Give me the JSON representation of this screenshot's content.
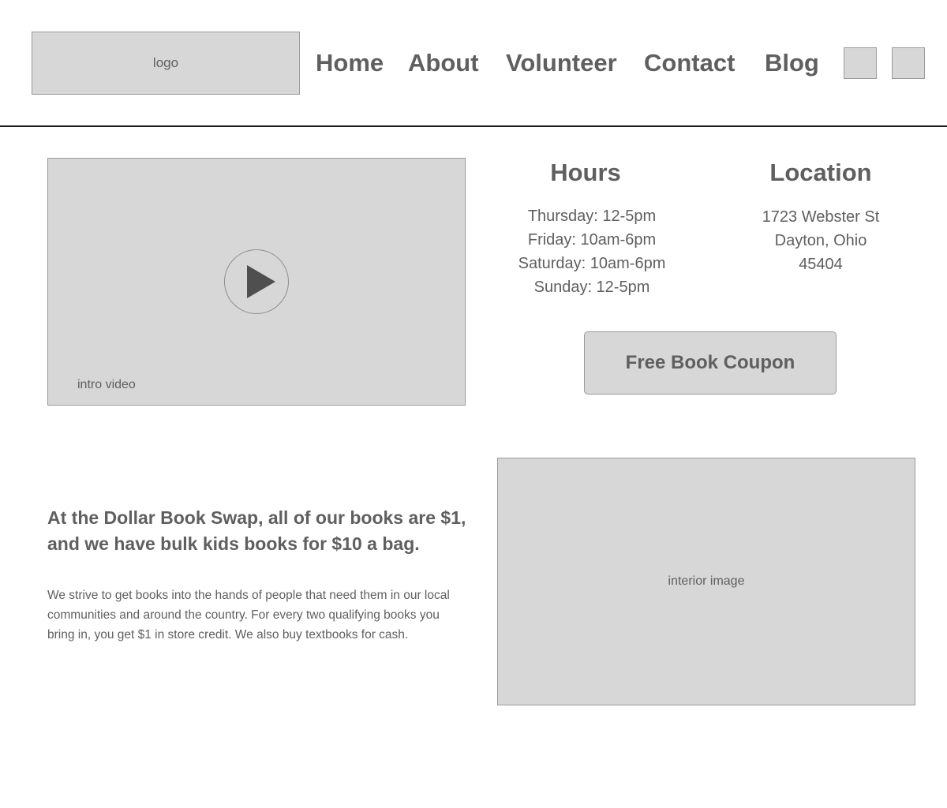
{
  "header": {
    "logo_label": "logo",
    "nav": {
      "home": "Home",
      "about": "About",
      "volunteer": "Volunteer",
      "contact": "Contact",
      "blog": "Blog"
    }
  },
  "video": {
    "caption": "intro video",
    "icon": "play-icon"
  },
  "hours": {
    "heading": "Hours",
    "items": [
      "Thursday: 12-5pm",
      "Friday: 10am-6pm",
      "Saturday: 10am-6pm",
      "Sunday: 12-5pm"
    ]
  },
  "location": {
    "heading": "Location",
    "lines": [
      "1723 Webster St",
      "Dayton, Ohio",
      "45404"
    ]
  },
  "coupon": {
    "label": "Free Book Coupon"
  },
  "about": {
    "heading": "At the Dollar Book Swap, all of our books are $1, and we have bulk kids books for $10 a bag.",
    "body": "We strive to get books into the hands of people that need them in our local communities and around the country. For every two qualifying books you bring in, you get $1 in store credit. We also buy textbooks for cash."
  },
  "interior_image": {
    "caption": "interior image"
  },
  "colors": {
    "placeholder_fill": "#d7d7d7",
    "placeholder_border": "#9b9b9b",
    "text": "#5f5f5f",
    "divider": "#1a1a1a"
  }
}
